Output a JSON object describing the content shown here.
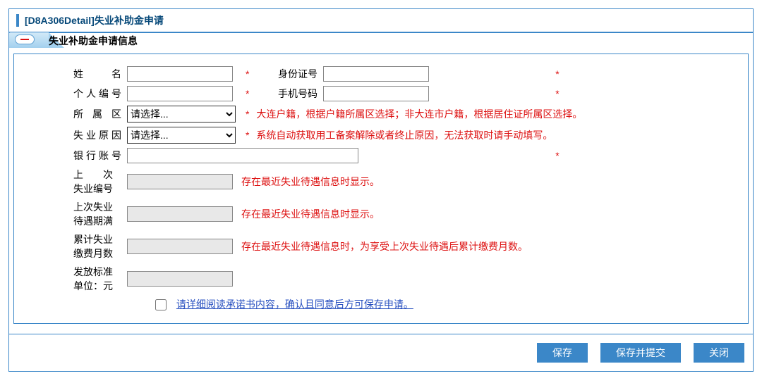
{
  "title": "[D8A306Detail]失业补助金申请",
  "section_title": "失业补助金申请信息",
  "labels": {
    "name": "姓　　名",
    "id_number": "身份证号",
    "personal_no": "个人编号",
    "phone": "手机号码",
    "district": "所 属 区",
    "unemp_reason": "失业原因",
    "bank_account": "银行账号",
    "last_unemp_no_l1": "上　　次",
    "last_unemp_no_l2": "失业编号",
    "last_expire_l1": "上次失业",
    "last_expire_l2": "待遇期满",
    "acc_months_l1": "累计失业",
    "acc_months_l2": "缴费月数",
    "pay_std_l1": "发放标准",
    "pay_std_l2": "单位：元"
  },
  "values": {
    "name": "",
    "id_number": "",
    "personal_no": "",
    "phone": "",
    "bank_account": "",
    "last_unemp_no": "",
    "last_expire": "",
    "acc_months": "",
    "pay_std": ""
  },
  "select_placeholder": "请选择...",
  "hints": {
    "district": "大连户籍，根据户籍所属区选择；非大连市户籍，根据居住证所属区选择。",
    "reason": "系统自动获取用工备案解除或者终止原因，无法获取时请手动填写。",
    "last_unemp_no": "存在最近失业待遇信息时显示。",
    "last_expire": "存在最近失业待遇信息时显示。",
    "acc_months": "存在最近失业待遇信息时，为享受上次失业待遇后累计缴费月数。"
  },
  "star": "*",
  "agreement_link": "请详细阅读承诺书内容，确认且同意后方可保存申请。",
  "buttons": {
    "save": "保存",
    "save_submit": "保存并提交",
    "close": "关闭"
  }
}
